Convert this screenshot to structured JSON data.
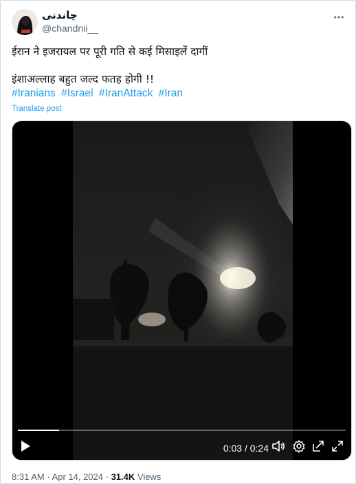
{
  "author": {
    "display_name": "چاندنی",
    "handle": "@chandnii__"
  },
  "post": {
    "line1": "ईरान ने इजरायल पर पूरी गति से कई मिसाइलें दागीं",
    "line2": "इंशाअल्लाह बहुत जल्द फतह होगी !!",
    "hashtags": [
      "#Iranians",
      "#Israel",
      "#IranAttack",
      "#Iran"
    ],
    "translate_label": "Translate post"
  },
  "video": {
    "current_time": "0:03",
    "separator": " / ",
    "duration": "0:24",
    "progress": 0.125
  },
  "meta": {
    "time": "8:31 AM",
    "dot1": " · ",
    "date": "Apr 14, 2024",
    "dot2": " · ",
    "views_count": "31.4K",
    "views_label": " Views"
  },
  "colors": {
    "accent": "#1d9bf0",
    "text": "#0f1419",
    "muted": "#536471"
  },
  "icons": {
    "more": "more-icon",
    "play": "play-icon",
    "volume": "volume-icon",
    "settings": "settings-icon",
    "popout": "popout-icon",
    "fullscreen": "fullscreen-icon"
  }
}
